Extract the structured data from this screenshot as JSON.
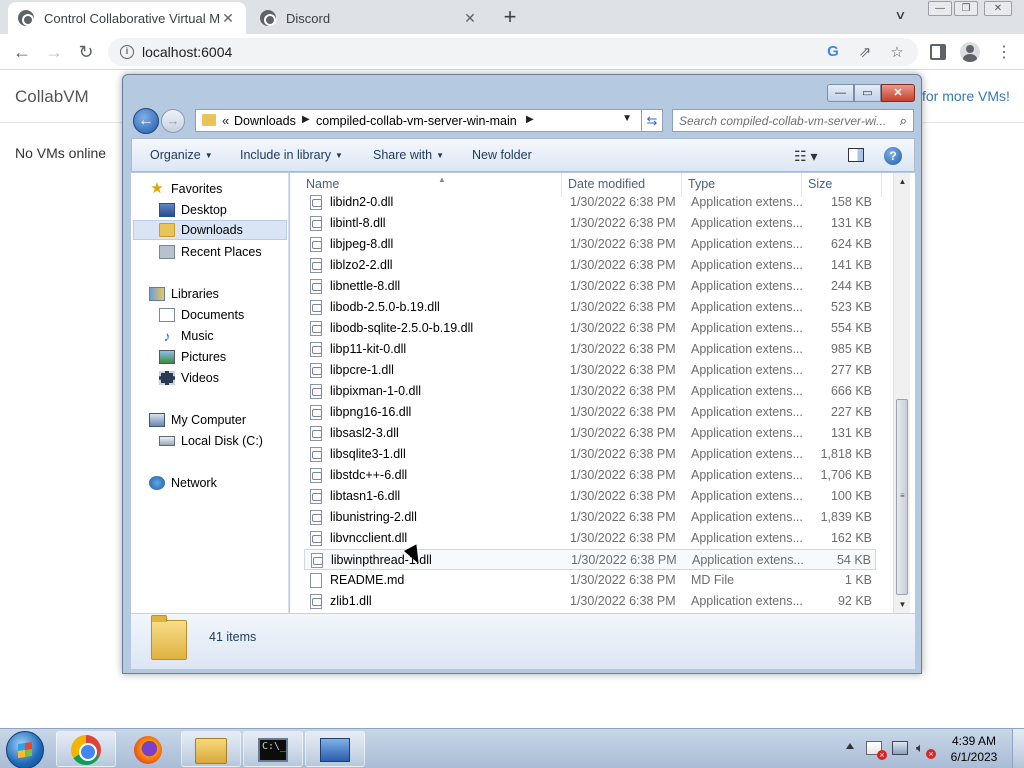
{
  "browser": {
    "tabs": [
      {
        "title": "Control Collaborative Virtual Ma",
        "active": true
      },
      {
        "title": "Discord",
        "active": false
      }
    ],
    "new_tab_label": "+",
    "url": "localhost:6004",
    "window_controls": {
      "minimize": "—",
      "maximize": "❐",
      "close": "✕"
    }
  },
  "page": {
    "brand": "CollabVM",
    "more_vms_link": "for more VMs!",
    "no_vms_text": "No VMs online"
  },
  "explorer": {
    "caption_buttons": {
      "minimize": "—",
      "maximize": "▭",
      "close": "✕"
    },
    "breadcrumb": {
      "prefix": "«",
      "parts": [
        "Downloads",
        "compiled-collab-vm-server-win-main"
      ]
    },
    "search_placeholder": "Search compiled-collab-vm-server-wi...",
    "commands": {
      "organize": "Organize",
      "include_in_library": "Include in library",
      "share_with": "Share with",
      "new_folder": "New folder"
    },
    "nav": {
      "favorites": "Favorites",
      "desktop": "Desktop",
      "downloads": "Downloads",
      "recent_places": "Recent Places",
      "libraries": "Libraries",
      "documents": "Documents",
      "music": "Music",
      "pictures": "Pictures",
      "videos": "Videos",
      "my_computer": "My Computer",
      "local_disk": "Local Disk (C:)",
      "network": "Network"
    },
    "columns": {
      "name": "Name",
      "date": "Date modified",
      "type": "Type",
      "size": "Size"
    },
    "files": [
      {
        "name": "libidn2-0.dll",
        "date": "1/30/2022 6:38 PM",
        "type": "Application extens...",
        "size": "158 KB",
        "icon": "dll-icon"
      },
      {
        "name": "libintl-8.dll",
        "date": "1/30/2022 6:38 PM",
        "type": "Application extens...",
        "size": "131 KB",
        "icon": "dll-icon"
      },
      {
        "name": "libjpeg-8.dll",
        "date": "1/30/2022 6:38 PM",
        "type": "Application extens...",
        "size": "624 KB",
        "icon": "dll-icon"
      },
      {
        "name": "liblzo2-2.dll",
        "date": "1/30/2022 6:38 PM",
        "type": "Application extens...",
        "size": "141 KB",
        "icon": "dll-icon"
      },
      {
        "name": "libnettle-8.dll",
        "date": "1/30/2022 6:38 PM",
        "type": "Application extens...",
        "size": "244 KB",
        "icon": "dll-icon"
      },
      {
        "name": "libodb-2.5.0-b.19.dll",
        "date": "1/30/2022 6:38 PM",
        "type": "Application extens...",
        "size": "523 KB",
        "icon": "dll-icon"
      },
      {
        "name": "libodb-sqlite-2.5.0-b.19.dll",
        "date": "1/30/2022 6:38 PM",
        "type": "Application extens...",
        "size": "554 KB",
        "icon": "dll-icon"
      },
      {
        "name": "libp11-kit-0.dll",
        "date": "1/30/2022 6:38 PM",
        "type": "Application extens...",
        "size": "985 KB",
        "icon": "dll-icon"
      },
      {
        "name": "libpcre-1.dll",
        "date": "1/30/2022 6:38 PM",
        "type": "Application extens...",
        "size": "277 KB",
        "icon": "dll-icon"
      },
      {
        "name": "libpixman-1-0.dll",
        "date": "1/30/2022 6:38 PM",
        "type": "Application extens...",
        "size": "666 KB",
        "icon": "dll-icon"
      },
      {
        "name": "libpng16-16.dll",
        "date": "1/30/2022 6:38 PM",
        "type": "Application extens...",
        "size": "227 KB",
        "icon": "dll-icon"
      },
      {
        "name": "libsasl2-3.dll",
        "date": "1/30/2022 6:38 PM",
        "type": "Application extens...",
        "size": "131 KB",
        "icon": "dll-icon"
      },
      {
        "name": "libsqlite3-1.dll",
        "date": "1/30/2022 6:38 PM",
        "type": "Application extens...",
        "size": "1,818 KB",
        "icon": "dll-icon"
      },
      {
        "name": "libstdc++-6.dll",
        "date": "1/30/2022 6:38 PM",
        "type": "Application extens...",
        "size": "1,706 KB",
        "icon": "dll-icon"
      },
      {
        "name": "libtasn1-6.dll",
        "date": "1/30/2022 6:38 PM",
        "type": "Application extens...",
        "size": "100 KB",
        "icon": "dll-icon"
      },
      {
        "name": "libunistring-2.dll",
        "date": "1/30/2022 6:38 PM",
        "type": "Application extens...",
        "size": "1,839 KB",
        "icon": "dll-icon"
      },
      {
        "name": "libvncclient.dll",
        "date": "1/30/2022 6:38 PM",
        "type": "Application extens...",
        "size": "162 KB",
        "icon": "dll-icon"
      },
      {
        "name": "libwinpthread-1.dll",
        "date": "1/30/2022 6:38 PM",
        "type": "Application extens...",
        "size": "54 KB",
        "icon": "dll-icon",
        "hover": true
      },
      {
        "name": "README.md",
        "date": "1/30/2022 6:38 PM",
        "type": "MD File",
        "size": "1 KB",
        "icon": "file-icon"
      },
      {
        "name": "zlib1.dll",
        "date": "1/30/2022 6:38 PM",
        "type": "Application extens...",
        "size": "92 KB",
        "icon": "dll-icon"
      }
    ],
    "status": {
      "item_count": "41 items"
    }
  },
  "taskbar": {
    "apps": [
      "chrome-icon",
      "firefox-icon",
      "explorer-icon",
      "cmd-icon",
      "remote-desktop-icon"
    ],
    "clock": {
      "time": "4:39 AM",
      "date": "6/1/2023"
    }
  }
}
